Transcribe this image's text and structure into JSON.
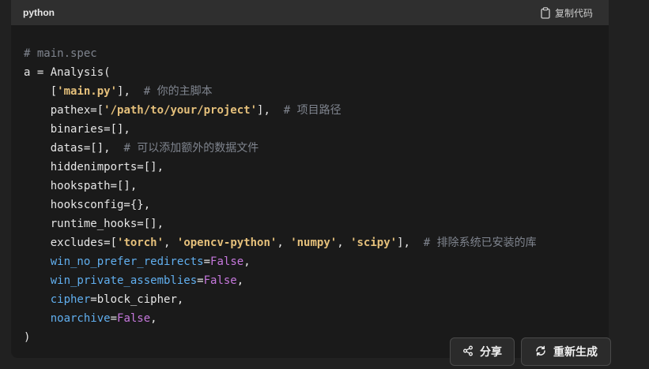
{
  "code_block": {
    "language": "python",
    "copy_label": "复制代码",
    "lines": [
      [
        {
          "t": "c-cm",
          "v": "# main.spec"
        }
      ],
      [
        {
          "t": "c-d",
          "v": "a = Analysis("
        }
      ],
      [
        {
          "t": "c-d",
          "v": "    ["
        },
        {
          "t": "c-str",
          "v": "'main.py'"
        },
        {
          "t": "c-d",
          "v": "],  "
        },
        {
          "t": "c-cm",
          "v": "# 你的主脚本"
        }
      ],
      [
        {
          "t": "c-d",
          "v": "    pathex=["
        },
        {
          "t": "c-str",
          "v": "'/path/to/your/project'"
        },
        {
          "t": "c-d",
          "v": "],  "
        },
        {
          "t": "c-cm",
          "v": "# 项目路径"
        }
      ],
      [
        {
          "t": "c-d",
          "v": "    binaries=[],"
        }
      ],
      [
        {
          "t": "c-d",
          "v": "    datas=[],  "
        },
        {
          "t": "c-cm",
          "v": "# 可以添加额外的数据文件"
        }
      ],
      [
        {
          "t": "c-d",
          "v": "    hiddenimports=[],"
        }
      ],
      [
        {
          "t": "c-d",
          "v": "    hookspath=[],"
        }
      ],
      [
        {
          "t": "c-d",
          "v": "    hooksconfig={},"
        }
      ],
      [
        {
          "t": "c-d",
          "v": "    runtime_hooks=[],"
        }
      ],
      [
        {
          "t": "c-d",
          "v": "    excludes=["
        },
        {
          "t": "c-str",
          "v": "'torch'"
        },
        {
          "t": "c-d",
          "v": ", "
        },
        {
          "t": "c-str",
          "v": "'opencv-python'"
        },
        {
          "t": "c-d",
          "v": ", "
        },
        {
          "t": "c-str",
          "v": "'numpy'"
        },
        {
          "t": "c-d",
          "v": ", "
        },
        {
          "t": "c-str",
          "v": "'scipy'"
        },
        {
          "t": "c-d",
          "v": "],  "
        },
        {
          "t": "c-cm",
          "v": "# 排除系统已安装的库"
        }
      ],
      [
        {
          "t": "c-d",
          "v": "    "
        },
        {
          "t": "c-kw",
          "v": "win_no_prefer_redirects"
        },
        {
          "t": "c-d",
          "v": "="
        },
        {
          "t": "c-bool",
          "v": "False"
        },
        {
          "t": "c-d",
          "v": ","
        }
      ],
      [
        {
          "t": "c-d",
          "v": "    "
        },
        {
          "t": "c-kw",
          "v": "win_private_assemblies"
        },
        {
          "t": "c-d",
          "v": "="
        },
        {
          "t": "c-bool",
          "v": "False"
        },
        {
          "t": "c-d",
          "v": ","
        }
      ],
      [
        {
          "t": "c-d",
          "v": "    "
        },
        {
          "t": "c-kw",
          "v": "cipher"
        },
        {
          "t": "c-d",
          "v": "=block_cipher,"
        }
      ],
      [
        {
          "t": "c-d",
          "v": "    "
        },
        {
          "t": "c-kw",
          "v": "noarchive"
        },
        {
          "t": "c-d",
          "v": "="
        },
        {
          "t": "c-bool",
          "v": "False"
        },
        {
          "t": "c-d",
          "v": ","
        }
      ],
      [
        {
          "t": "c-d",
          "v": ")"
        }
      ]
    ]
  },
  "actions": {
    "share_label": "分享",
    "regenerate_label": "重新生成"
  },
  "colors": {
    "comment": "#7f848e",
    "string": "#e5c07b",
    "keyword_arg": "#61afef",
    "boolean": "#c678dd",
    "code_bg": "#1a1a1a",
    "header_bg": "#2f2f2f"
  },
  "icons": {
    "copy": "clipboard-icon",
    "share": "share-icon",
    "regenerate": "refresh-icon"
  }
}
